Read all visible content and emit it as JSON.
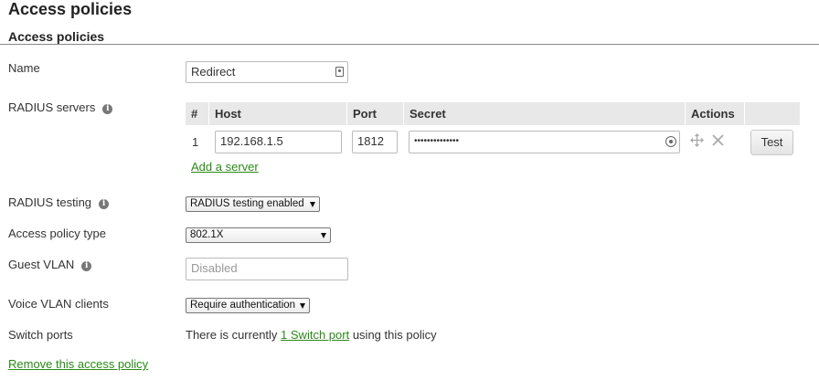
{
  "page": {
    "title": "Access policies"
  },
  "section": {
    "title": "Access policies"
  },
  "name_field": {
    "label": "Name",
    "value": "Redirect"
  },
  "radius_servers": {
    "label": "RADIUS servers",
    "columns": {
      "number": "#",
      "host": "Host",
      "port": "Port",
      "secret": "Secret",
      "actions": "Actions"
    },
    "rows": [
      {
        "number": "1",
        "host": "192.168.1.5",
        "port": "1812",
        "secret": "••••••••••••••",
        "test_label": "Test"
      }
    ],
    "add_server_label": "Add a server"
  },
  "radius_testing": {
    "label": "RADIUS testing",
    "selected": "RADIUS testing enabled"
  },
  "access_policy_type": {
    "label": "Access policy type",
    "selected": "802.1X"
  },
  "guest_vlan": {
    "label": "Guest VLAN",
    "placeholder": "Disabled"
  },
  "voice_vlan_clients": {
    "label": "Voice VLAN clients",
    "selected": "Require authentication"
  },
  "switch_ports": {
    "label": "Switch ports",
    "prefix": "There is currently",
    "link": "1 Switch port",
    "suffix": "using this policy"
  },
  "remove_label": "Remove this access policy",
  "colors": {
    "link": "#2a8a17",
    "table_header_bg": "#e8e8e8",
    "rule": "#888888"
  }
}
